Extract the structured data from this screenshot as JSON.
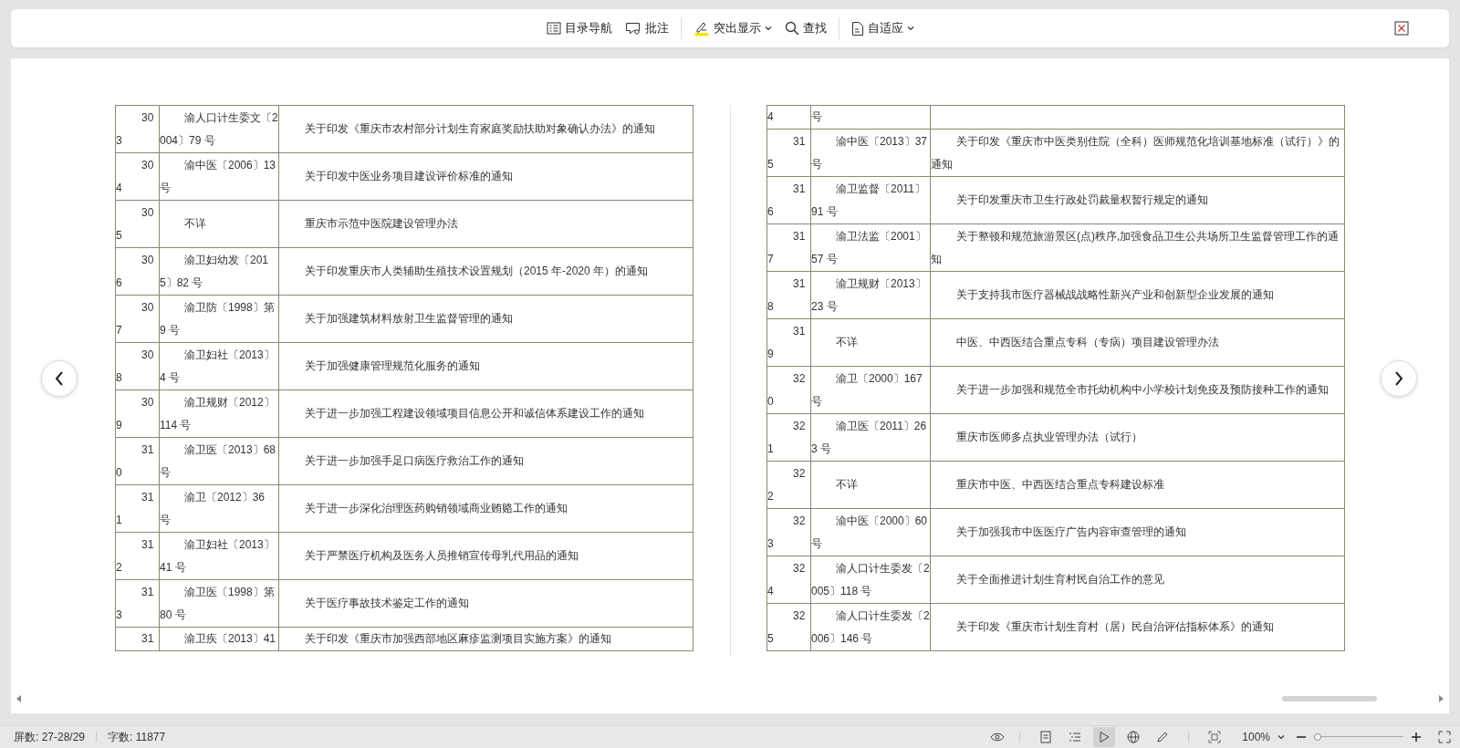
{
  "toolbar": {
    "groups": [
      [
        {
          "kind": "toc",
          "label": "目录导航",
          "dropdown": false
        },
        {
          "kind": "comment",
          "label": "批注",
          "dropdown": false
        }
      ],
      [
        {
          "kind": "highlight",
          "label": "突出显示",
          "dropdown": true
        },
        {
          "kind": "find",
          "label": "查找",
          "dropdown": false
        }
      ],
      [
        {
          "kind": "fit",
          "label": "自适应",
          "dropdown": true
        }
      ]
    ]
  },
  "pages": [
    {
      "rows": [
        {
          "kind": "full",
          "number": "303",
          "code": "渝人口计生委文〔2004〕79 号",
          "title": "关于印发《重庆市农村部分计划生育家庭奖励扶助对象确认办法》的通知"
        },
        {
          "kind": "full",
          "number": "304",
          "code": "渝中医〔2006〕13 号",
          "title": "关于印发中医业务项目建设评价标准的通知"
        },
        {
          "kind": "full",
          "number": "305",
          "code": "不详",
          "title": "重庆市示范中医院建设管理办法"
        },
        {
          "kind": "full",
          "number": "306",
          "code": "渝卫妇幼发〔2015〕82 号",
          "title": "关于印发重庆市人类辅助生殖技术设置规划（2015 年-2020 年）的通知"
        },
        {
          "kind": "full",
          "number": "307",
          "code": "渝卫防〔1998〕第 9 号",
          "title": "关于加强建筑材料放射卫生监督管理的通知"
        },
        {
          "kind": "full",
          "number": "308",
          "code": "渝卫妇社〔2013〕4 号",
          "title": "关于加强健康管理规范化服务的通知"
        },
        {
          "kind": "full",
          "number": "309",
          "code": "渝卫规财〔2012〕114 号",
          "title": "关于进一步加强工程建设领域项目信息公开和诚信体系建设工作的通知"
        },
        {
          "kind": "full",
          "number": "310",
          "code": "渝卫医〔2013〕68 号",
          "title": "关于进一步加强手足口病医疗救治工作的通知"
        },
        {
          "kind": "full",
          "number": "311",
          "code": "渝卫〔2012〕36 号",
          "title": "关于进一步深化治理医药购销领域商业贿赂工作的通知"
        },
        {
          "kind": "full",
          "number": "312",
          "code": "渝卫妇社〔2013〕41 号",
          "title": "关于严禁医疗机构及医务人员推销宣传母乳代用品的通知"
        },
        {
          "kind": "full",
          "number": "313",
          "code": "渝卫医〔1998〕第 80 号",
          "title": "关于医疗事故技术鉴定工作的通知"
        },
        {
          "kind": "cut_bottom",
          "number": "31",
          "code": "渝卫疾〔2013〕41",
          "title": "关于印发《重庆市加强西部地区麻疹监测项目实施方案》的通知"
        }
      ]
    },
    {
      "rows": [
        {
          "kind": "cut_top",
          "number": "4",
          "code": "号"
        },
        {
          "kind": "full",
          "number": "315",
          "code": "渝中医〔2013〕37 号",
          "title": "关于印发《重庆市中医类别住院（全科）医师规范化培训基地标准（试行）》的通知"
        },
        {
          "kind": "full",
          "number": "316",
          "code": "渝卫监督〔2011〕91 号",
          "title": "关于印发重庆市卫生行政处罚裁量权暂行规定的通知"
        },
        {
          "kind": "full",
          "number": "317",
          "code": "渝卫法监〔2001〕57 号",
          "title": "关于整顿和规范旅游景区(点)秩序,加强食品卫生公共场所卫生监督管理工作的通知"
        },
        {
          "kind": "full",
          "number": "318",
          "code": "渝卫规财〔2013〕23 号",
          "title": "关于支持我市医疗器械战战略性新兴产业和创新型企业发展的通知"
        },
        {
          "kind": "full",
          "number": "319",
          "code": "不详",
          "title": "中医、中西医结合重点专科（专病）项目建设管理办法"
        },
        {
          "kind": "full",
          "number": "320",
          "code": "渝卫〔2000〕167 号",
          "title": "关于进一步加强和规范全市托幼机构中小学校计划免疫及预防接种工作的通知"
        },
        {
          "kind": "full",
          "number": "321",
          "code": "渝卫医〔2011〕263 号",
          "title": "重庆市医师多点执业管理办法（试行）"
        },
        {
          "kind": "full",
          "number": "322",
          "code": "不详",
          "title": "重庆市中医、中西医结合重点专科建设标准"
        },
        {
          "kind": "full",
          "number": "323",
          "code": "渝中医〔2000〕60 号",
          "title": "关于加强我市中医医疗广告内容审查管理的通知"
        },
        {
          "kind": "full",
          "number": "324",
          "code": "渝人口计生委发〔2005〕118 号",
          "title": "关于全面推进计划生育村民自治工作的意见"
        },
        {
          "kind": "full",
          "number": "325",
          "code": "渝人口计生委发〔2006〕146 号",
          "title": "关于印发《重庆市计划生育村（居）民自治评估指标体系》的通知"
        }
      ]
    }
  ],
  "status_bar": {
    "screen_count": "屏数: 27-28/29",
    "word_count": "字数: 11877",
    "view_modes": [
      {
        "kind": "page",
        "selected": false
      },
      {
        "kind": "outline",
        "selected": false
      },
      {
        "kind": "play",
        "selected": true
      },
      {
        "kind": "web",
        "selected": false
      },
      {
        "kind": "pen",
        "selected": false
      }
    ],
    "zoom": {
      "value": "100%",
      "level": 0.04
    }
  }
}
